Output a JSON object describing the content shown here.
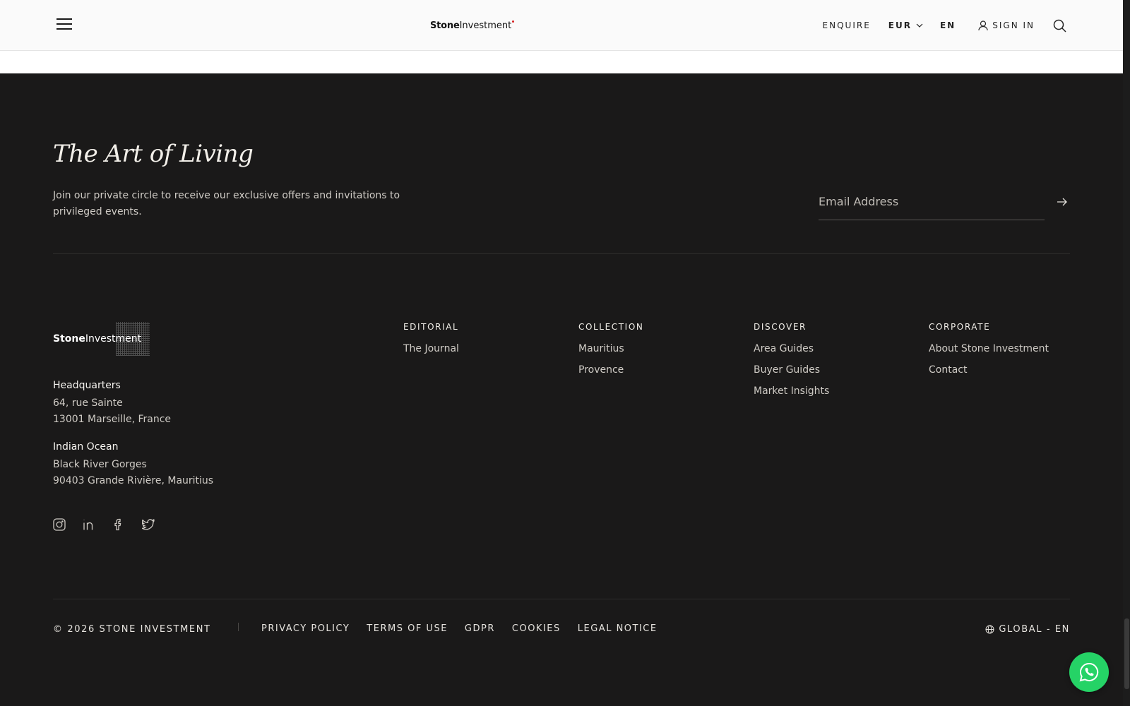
{
  "header": {
    "logo_bold": "Stone",
    "logo_regular": "Investment",
    "enquire": "ENQUIRE",
    "currency": "EUR",
    "language": "EN",
    "sign_in": "SIGN IN"
  },
  "newsletter": {
    "title": "The Art of Living",
    "description": "Join our private circle to receive our exclusive offers and invitations to privileged events.",
    "email_placeholder": "Email Address"
  },
  "footer": {
    "logo_bold": "Stone",
    "logo_regular": "Investment",
    "hq_title": "Headquarters",
    "hq_line1": "64, rue Sainte",
    "hq_line2": "13001 Marseille, France",
    "io_title": "Indian Ocean",
    "io_line1": "Black River Gorges",
    "io_line2": "90403 Grande Rivière, Mauritius",
    "columns": [
      {
        "title": "EDITORIAL",
        "links": [
          "The Journal"
        ]
      },
      {
        "title": "COLLECTION",
        "links": [
          "Mauritius",
          "Provence"
        ]
      },
      {
        "title": "DISCOVER",
        "links": [
          "Area Guides",
          "Buyer Guides",
          "Market Insights"
        ]
      },
      {
        "title": "CORPORATE",
        "links": [
          "About Stone Investment",
          "Contact"
        ]
      }
    ]
  },
  "bottom": {
    "copyright": "© 2026 STONE INVESTMENT",
    "legal": [
      "PRIVACY POLICY",
      "TERMS OF USE",
      "GDPR",
      "COOKIES",
      "LEGAL NOTICE"
    ],
    "region": "GLOBAL - EN"
  },
  "colors": {
    "background": "#1a1919",
    "header": "#fafafa",
    "whatsapp": "#25d366",
    "logo_dot": "#d62020"
  }
}
